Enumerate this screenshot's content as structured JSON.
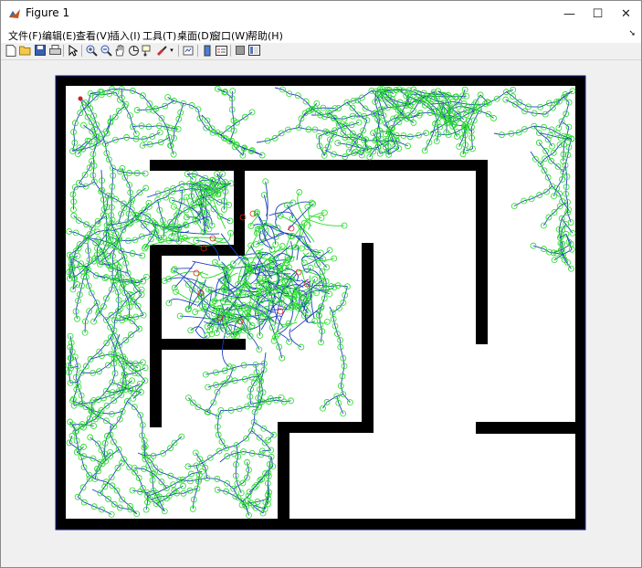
{
  "window": {
    "title": "Figure 1",
    "minimize_glyph": "—",
    "maximize_glyph": "☐",
    "close_glyph": "✕",
    "icon": "matlab-figure-icon"
  },
  "menu": {
    "items": [
      {
        "label": "文件(F)"
      },
      {
        "label": "编辑(E)"
      },
      {
        "label": "查看(V)"
      },
      {
        "label": "插入(I)"
      },
      {
        "label": "工具(T)"
      },
      {
        "label": "桌面(D)"
      },
      {
        "label": "窗口(W)"
      },
      {
        "label": "帮助(H)"
      }
    ],
    "dock_arrow": "➘"
  },
  "toolbar": {
    "icons": [
      "new-figure-icon",
      "open-file-icon",
      "save-icon",
      "print-icon",
      "edit-plot-arrow-icon",
      "zoom-in-icon",
      "zoom-out-icon",
      "pan-hand-icon",
      "rotate-3d-icon",
      "data-cursor-icon",
      "brush-icon",
      "link-plot-icon",
      "colorbar-icon",
      "legend-icon",
      "hide-plot-tools-icon",
      "show-plot-tools-icon"
    ]
  },
  "figure": {
    "description_colors": {
      "wall": "#000000",
      "free_space": "#ffffff",
      "tree_edge": "#1f3fbf",
      "tree_node": "#22dd22",
      "collision_node": "#e02020",
      "start_marker": "#cc2222"
    }
  }
}
